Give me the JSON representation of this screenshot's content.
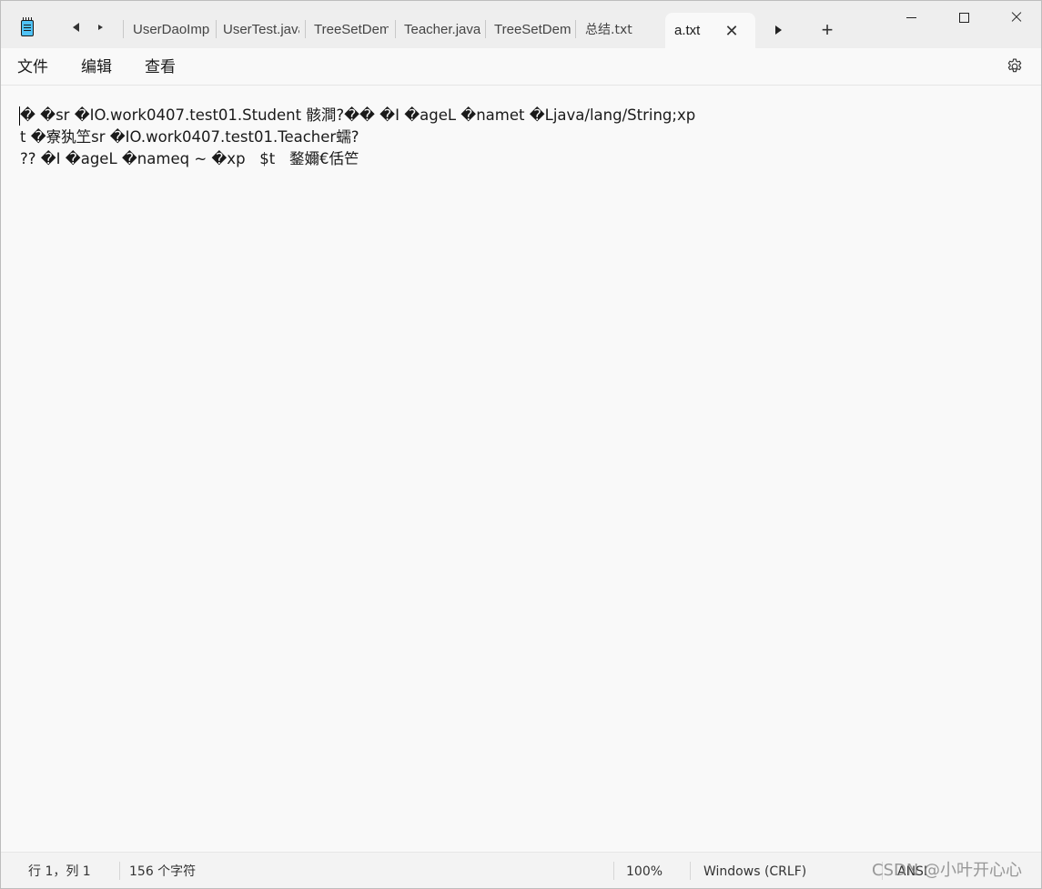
{
  "titlebar": {
    "app_icon": "notepad-icon",
    "tabs": [
      {
        "label": "UserDaoImp"
      },
      {
        "label": "UserTest.java"
      },
      {
        "label": "TreeSetDemo"
      },
      {
        "label": "Teacher.java"
      },
      {
        "label": "TreeSetDemo"
      },
      {
        "label": "总结.txt"
      }
    ],
    "active_tab": {
      "label": "a.txt",
      "close_glyph": "✕"
    },
    "new_tab_glyph": "+"
  },
  "menu": {
    "file": "文件",
    "edit": "编辑",
    "view": "查看"
  },
  "editor": {
    "lines": [
      "� �sr �IO.work0407.test01.Student 骸澗?�� �I �ageL �namet �Ljava/lang/String;xp",
      "t �寮犱笁sr �IO.work0407.test01.Teacher蠕?",
      "?? �I �ageL �nameq ~ �xp   $t   鍪嬭€佸笀"
    ]
  },
  "status": {
    "position": "行 1，列 1",
    "char_count": "156 个字符",
    "zoom": "100%",
    "line_ending": "Windows (CRLF)",
    "encoding": "ANSI",
    "watermark": "CSDN @小叶开心心"
  }
}
